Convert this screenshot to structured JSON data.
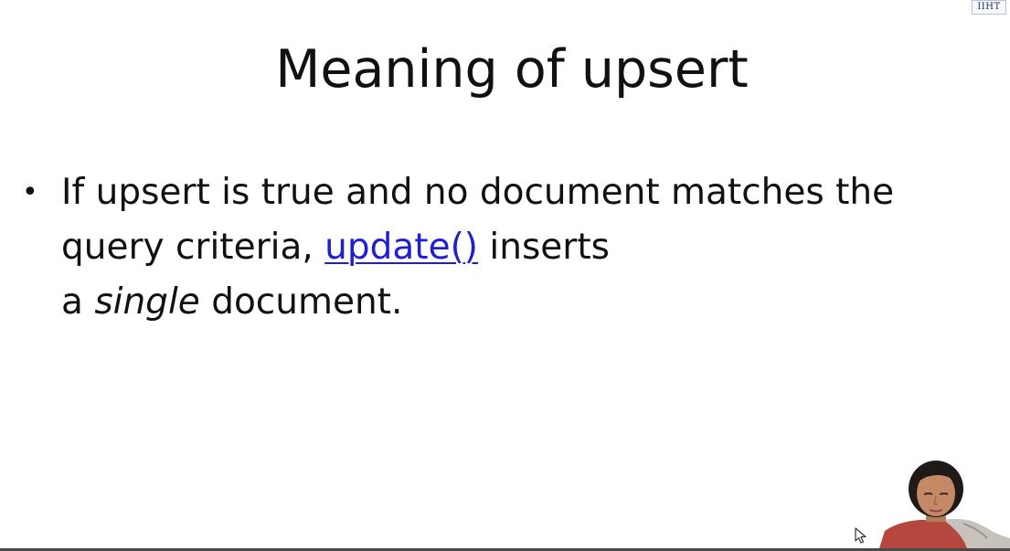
{
  "slide": {
    "title": "Meaning of upsert",
    "bullet": {
      "line1": "If upsert is true and no document matches the",
      "line2_prefix": "query criteria,",
      "link": "update()",
      "line2_suffix": "inserts",
      "line3_prefix": "a",
      "line3_italic": "single",
      "line3_suffix": "document."
    }
  },
  "logo": {
    "text": "IIHT"
  },
  "colors": {
    "text": "#111111",
    "link": "#1f1fd0",
    "background": "#ffffff"
  },
  "icons": [
    "mouse-cursor-icon",
    "presenter-video"
  ]
}
